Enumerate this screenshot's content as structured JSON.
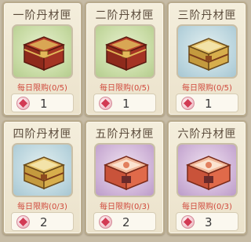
{
  "items": [
    {
      "name": "一阶丹材匣",
      "limit": "每日限购(0/5)",
      "price": "1",
      "tier_color": "green",
      "chest_color": "red"
    },
    {
      "name": "二阶丹材匣",
      "limit": "每日限购(0/5)",
      "price": "1",
      "tier_color": "green",
      "chest_color": "red"
    },
    {
      "name": "三阶丹材匣",
      "limit": "每日限购(0/5)",
      "price": "1",
      "tier_color": "blue",
      "chest_color": "gold"
    },
    {
      "name": "四阶丹材匣",
      "limit": "每日限购(0/3)",
      "price": "2",
      "tier_color": "blue",
      "chest_color": "gold"
    },
    {
      "name": "五阶丹材匣",
      "limit": "每日限购(0/3)",
      "price": "2",
      "tier_color": "purple",
      "chest_color": "pink"
    },
    {
      "name": "六阶丹材匣",
      "limit": "每日限购(0/3)",
      "price": "3",
      "tier_color": "purple",
      "chest_color": "pink"
    }
  ],
  "currency_icon": "gem-icon",
  "colors": {
    "limit_text": "#d0493c",
    "title_text": "#5a4a3a",
    "card_bg": "#f4eedc",
    "border": "#b9ab8d"
  }
}
